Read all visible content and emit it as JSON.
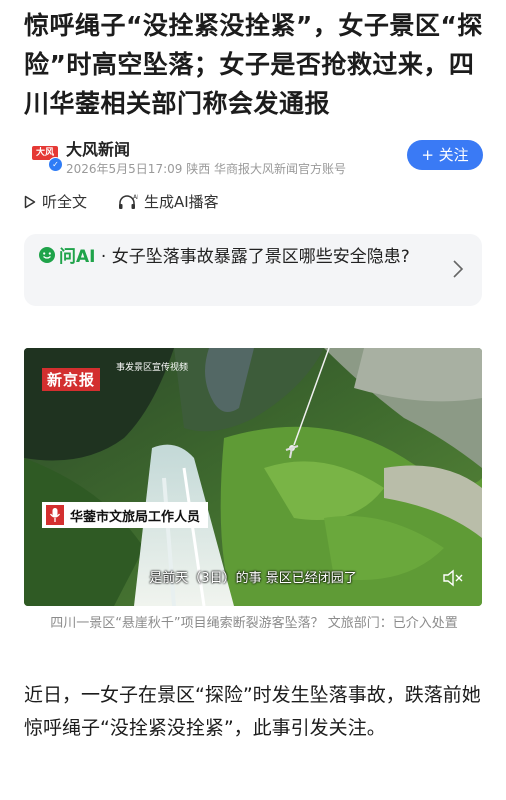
{
  "article": {
    "title": "惊呼绳子“没拴紧没拴紧”，女子景区“探险”时高空坠落；女子是否抢救过来，四川华蓥相关部门称会发通报",
    "author": {
      "name": "大风新闻",
      "logo_text": "大风",
      "meta": "2026年5月5日17:09 陕西 华商报大风新闻官方账号",
      "follow_label": "+ 关注"
    },
    "tools": {
      "listen_label": "听全文",
      "ai_broadcast_label": "生成AI播客",
      "ai_icon_text": "AI"
    },
    "ai_question": {
      "brand": "问AI",
      "separator": " · ",
      "question": "女子坠落事故暴露了景区哪些安全隐患?"
    },
    "image": {
      "watermark_logo": "新京报",
      "source_tag": "事发景区宣传视频",
      "speaker_label": "华蓥市文旅局工作人员",
      "subtitle": "是前天（3日）的事 景区已经闭园了"
    },
    "caption": "四川一景区“悬崖秋千”项目绳索断裂游客坠落？ 文旅部门：已介入处置",
    "body": "近日，一女子在景区“探险”时发生坠落事故，跌落前她惊呼绳子“没拴紧没拴紧”，此事引发关注。"
  },
  "colors": {
    "accent_blue": "#3a7af5",
    "ai_green": "#1fa34a",
    "news_red": "#e53935"
  }
}
